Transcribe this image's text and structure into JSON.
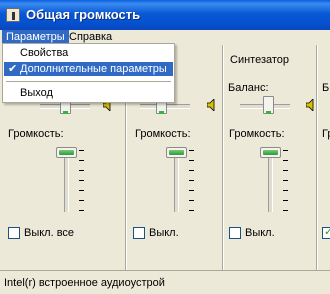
{
  "window": {
    "title": "Общая громкость"
  },
  "menubar": {
    "items": [
      {
        "label": "Параметры"
      },
      {
        "label": "Справка"
      }
    ]
  },
  "dropdown": {
    "items": [
      {
        "label": "Свойства",
        "checked": false,
        "selected": false
      },
      {
        "label": "Дополнительные параметры",
        "checked": true,
        "selected": true
      },
      {
        "label": "Выход",
        "checked": false,
        "selected": false
      }
    ]
  },
  "columns": [
    {
      "title": "",
      "balance_label": "",
      "volume_label": "Громкость:",
      "mute_label": "Выкл. все",
      "muted": false
    },
    {
      "title": "",
      "balance_label": "",
      "volume_label": "Громкость:",
      "mute_label": "Выкл.",
      "muted": false
    },
    {
      "title": "Синтезатор",
      "balance_label": "Баланс:",
      "volume_label": "Громкость:",
      "mute_label": "Выкл.",
      "muted": false
    },
    {
      "title": "",
      "balance_label": "Б",
      "volume_label": "Гр",
      "mute_label": "",
      "muted": true
    }
  ],
  "status": {
    "text": "Intel(r) встроенное аудиоустрой"
  }
}
